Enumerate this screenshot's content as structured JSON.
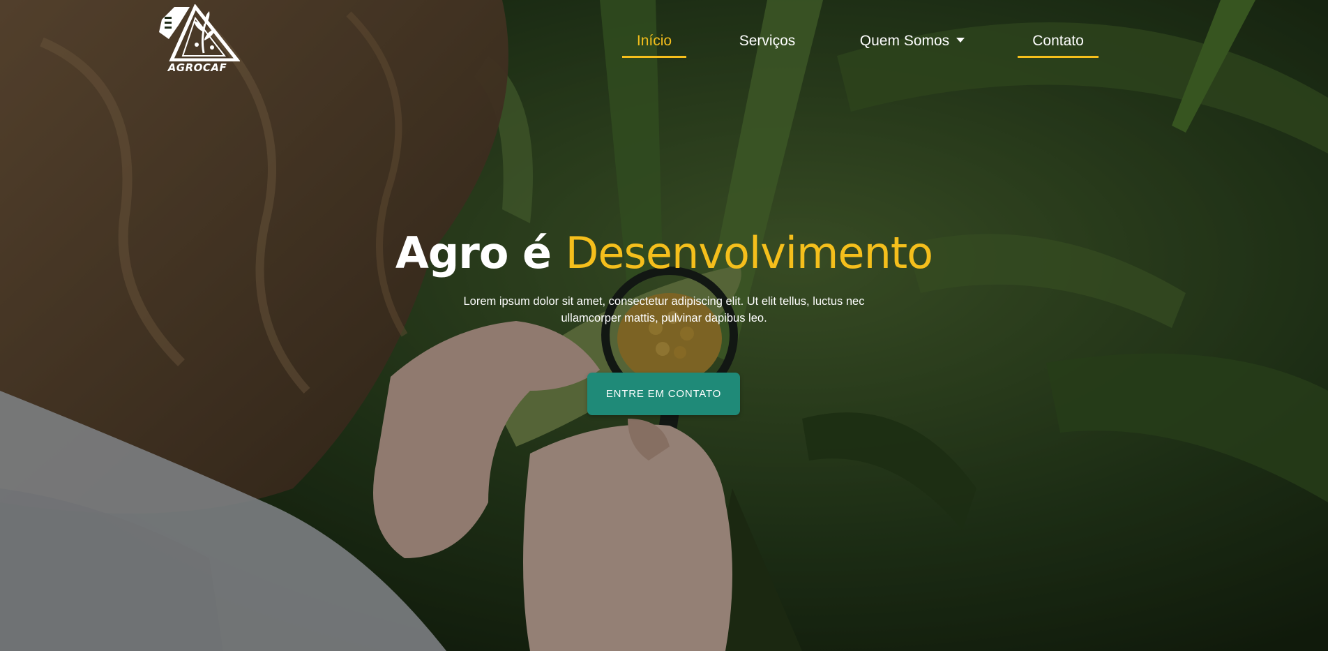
{
  "brand": {
    "logo_text": "AGROCAF",
    "accent_color": "#f5bf1c",
    "button_color": "#1f8a78"
  },
  "nav": {
    "items": [
      {
        "label": "Início",
        "active": true
      },
      {
        "label": "Serviços",
        "active": false
      },
      {
        "label": "Quem Somos",
        "active": false,
        "has_dropdown": true
      },
      {
        "label": "Contato",
        "active": false
      }
    ]
  },
  "hero": {
    "headline_part1": "Agro é ",
    "headline_accent": "Desenvolvimento",
    "subtitle": "Lorem ipsum dolor sit amet, consectetur adipiscing elit. Ut elit tellus, luctus nec ullamcorper mattis, pulvinar dapibus leo.",
    "cta_label": "ENTRE EM CONTATO"
  },
  "background": {
    "icon": "corn-field-photo"
  }
}
